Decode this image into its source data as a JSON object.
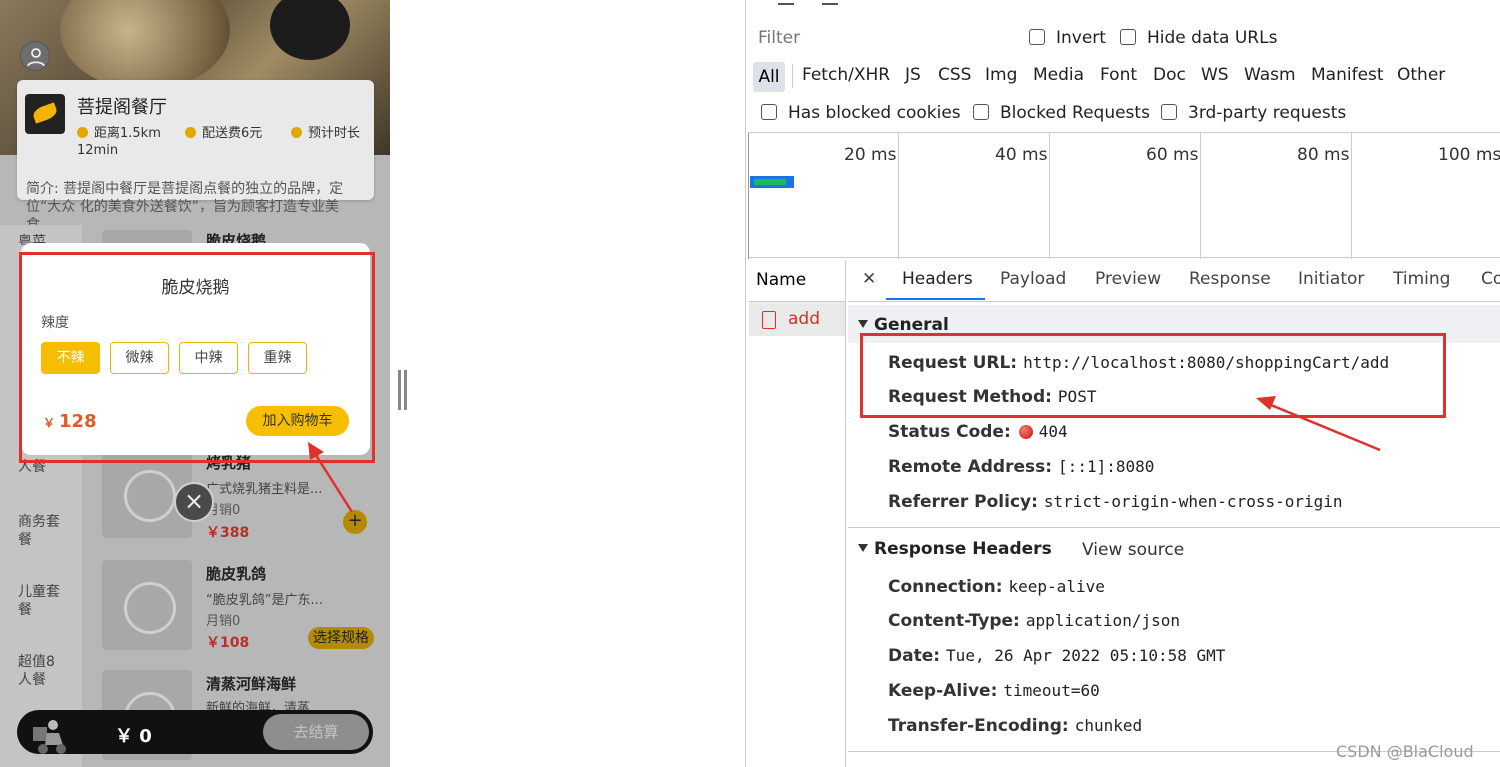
{
  "mobile": {
    "shop_name": "菩提阁餐厅",
    "distance": "距离1.5km",
    "delivery_fee": "配送费6元",
    "eta_label": "预计时长",
    "eta_value": "12min",
    "description": "简介: 菩提阁中餐厅是菩提阁点餐的独立的品牌，定位“大众 化的美食外送餐饮”，旨为顾客打造专业美食。",
    "categories": [
      {
        "label": "粤菜"
      },
      {
        "label": "人餐"
      },
      {
        "label": "商务套餐"
      },
      {
        "label": "儿童套餐"
      },
      {
        "label": "超值8人餐"
      }
    ],
    "items": [
      {
        "name": "脆皮烧鹅"
      },
      {
        "name": "烤乳猪",
        "desc": "广式烧乳猪主料是...",
        "sales": "月销0",
        "price": "￥388"
      },
      {
        "name": "脆皮乳鸽",
        "desc": "“脆皮乳鸽”是广东...",
        "sales": "月销0",
        "price": "￥108"
      },
      {
        "name": "清蒸河鲜海鲜",
        "desc": "新鲜的海鲜，清蒸"
      }
    ],
    "select_spec": "选择规格",
    "plus": "+",
    "close": "×",
    "cart_total": "￥ 0",
    "checkout": "去结算",
    "modal": {
      "title": "脆皮烧鹅",
      "spicy_label": "辣度",
      "options": [
        "不辣",
        "微辣",
        "中辣",
        "重辣"
      ],
      "selected": "不辣",
      "currency": "￥",
      "price": "128",
      "add_to_cart": "加入购物车"
    }
  },
  "devtools": {
    "filter_placeholder": "Filter",
    "invert": "Invert",
    "hide_data_urls": "Hide data URLs",
    "types": [
      "All",
      "Fetch/XHR",
      "JS",
      "CSS",
      "Img",
      "Media",
      "Font",
      "Doc",
      "WS",
      "Wasm",
      "Manifest",
      "Other"
    ],
    "has_blocked_cookies": "Has blocked cookies",
    "blocked_requests": "Blocked Requests",
    "third_party": "3rd-party requests",
    "waterfall_ticks": [
      "20 ms",
      "40 ms",
      "60 ms",
      "80 ms",
      "100 ms"
    ],
    "name_header": "Name",
    "request_name": "add",
    "tabs": [
      "Headers",
      "Payload",
      "Preview",
      "Response",
      "Initiator",
      "Timing",
      "Co"
    ],
    "general": {
      "title": "General",
      "request_url_key": "Request URL:",
      "request_url": "http://localhost:8080/shoppingCart/add",
      "request_method_key": "Request Method:",
      "request_method": "POST",
      "status_code_key": "Status Code:",
      "status_code": "404",
      "remote_address_key": "Remote Address:",
      "remote_address": "[::1]:8080",
      "referrer_policy_key": "Referrer Policy:",
      "referrer_policy": "strict-origin-when-cross-origin"
    },
    "response_headers": {
      "title": "Response Headers",
      "view_source": "View source",
      "connection_key": "Connection:",
      "connection": "keep-alive",
      "content_type_key": "Content-Type:",
      "content_type": "application/json",
      "date_key": "Date:",
      "date": "Tue, 26 Apr 2022 05:10:58 GMT",
      "keep_alive_key": "Keep-Alive:",
      "keep_alive": "timeout=60",
      "transfer_encoding_key": "Transfer-Encoding:",
      "transfer_encoding": "chunked"
    }
  },
  "watermark": "CSDN @BlaCloud",
  "colors": {
    "accent_yellow": "#f7be00",
    "annotation_red": "#e0312d",
    "devtools_blue": "#1a73e8",
    "price_red": "#e35a24"
  }
}
